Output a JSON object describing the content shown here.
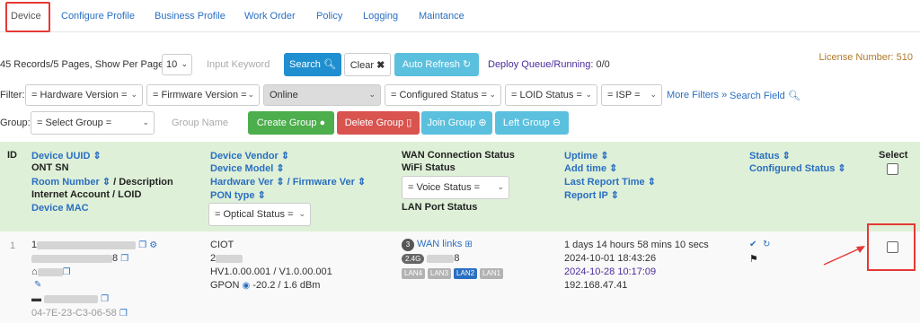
{
  "tabs": [
    "Device",
    "Configure Profile",
    "Business Profile",
    "Work Order",
    "Policy",
    "Logging",
    "Maintance"
  ],
  "toolbar": {
    "records_text": "45 Records/5 Pages, Show Per Page:",
    "per_page": "10",
    "keyword_placeholder": "Input Keyword",
    "search_label": "Search",
    "clear_label": "Clear",
    "auto_refresh_label": "Auto Refresh",
    "deploy_label": "Deploy Queue/Running:",
    "deploy_value": "0/0",
    "license_text": "License Number: 510"
  },
  "filters": {
    "label": "Filter:",
    "hardware": "= Hardware Version =",
    "firmware": "= Firmware Version =",
    "online": "Online",
    "configured": "= Configured Status =",
    "loid": "= LOID Status =",
    "isp": "= ISP =",
    "more_filters": "More Filters »",
    "search_field": "Search Field"
  },
  "group": {
    "label": "Group:",
    "select": "= Select Group =",
    "name_placeholder": "Group Name",
    "create": "Create Group",
    "delete": "Delete Group",
    "join": "Join Group",
    "left": "Left Group"
  },
  "table": {
    "id": "ID",
    "uuid": "Device UUID",
    "ont_sn": "ONT SN",
    "room": "Room Number",
    "description": "/ Description",
    "internet": "Internet Account / LOID",
    "mac": "Device MAC",
    "vendor": "Device Vendor",
    "model": "Device Model",
    "hw_ver": "Hardware Ver",
    "fw_ver": "/ Firmware Ver",
    "pon_type": "PON type",
    "optical_status": "= Optical Status =",
    "wan_status": "WAN Connection Status",
    "wifi_status": "WiFi Status",
    "voice_status": "= Voice Status =",
    "lan_status": "LAN Port Status",
    "uptime": "Uptime",
    "add_time": "Add time",
    "last_report": "Last Report Time",
    "report_ip": "Report IP",
    "status": "Status",
    "configured_status": "Configured Status",
    "select": "Select"
  },
  "row": {
    "id": "1",
    "uuid_prefix": "1",
    "sn_suffix": "8",
    "mac": "04-7E-23-C3-06-58",
    "vendor": "CIOT",
    "model_prefix": "2",
    "versions": "HV1.0.00.001 / V1.0.00.001",
    "pon": "GPON",
    "optical": "-20.2 / 1.6 dBm",
    "wan_count": "3",
    "wan_links": "WAN links",
    "wifi_band": "2.4G",
    "wifi_count": "8",
    "lan_ports": [
      "LAN4",
      "LAN3",
      "LAN2",
      "LAN1"
    ],
    "uptime": "1 days 14 hours 58 mins 10 secs",
    "add_time": "2024-10-01 18:43:26",
    "last_report": "2024-10-28 10:17:09",
    "report_ip": "192.168.47.41"
  }
}
